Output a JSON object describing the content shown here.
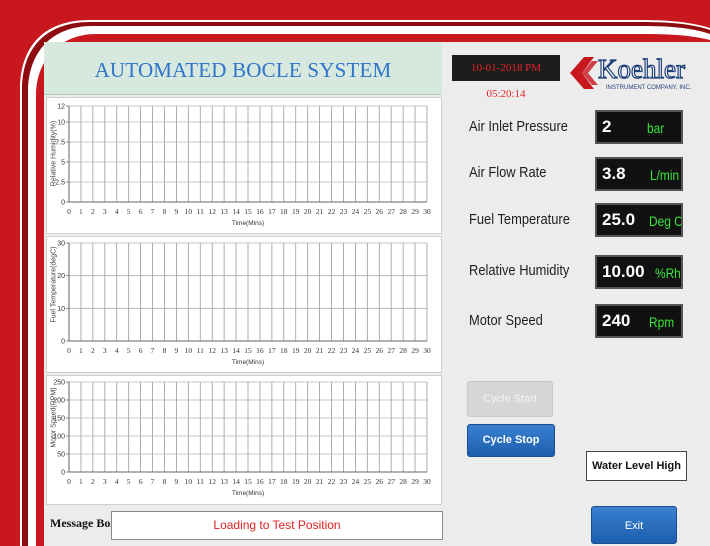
{
  "app": {
    "title": "AUTOMATED BOCLE SYSTEM",
    "datetime": "10-01-2018 PM 05:20:14"
  },
  "logo": {
    "name": "Koehler",
    "subtitle": "INSTRUMENT COMPANY, INC."
  },
  "colors": {
    "frame_red": "#c8171d",
    "title_blue": "#2e74c9",
    "value_green": "#37e637",
    "message_red": "#e02020",
    "button_blue": "#1d5fae"
  },
  "parameters": [
    {
      "label": "Air Inlet Pressure",
      "value": "2",
      "unit": "bar"
    },
    {
      "label": "Air Flow Rate",
      "value": "3.8",
      "unit": "L/min"
    },
    {
      "label": "Fuel Temperature",
      "value": "25.0",
      "unit": "Deg C"
    },
    {
      "label": "Relative Humidity",
      "value": "10.00",
      "unit": "%Rh"
    },
    {
      "label": "Motor Speed",
      "value": "240",
      "unit": "Rpm"
    }
  ],
  "buttons": {
    "cycle_start": "Cycle Start",
    "cycle_stop": "Cycle Stop",
    "exit": "Exit"
  },
  "status": {
    "water_level": "Water Level High"
  },
  "message": {
    "label": "Message Box",
    "text": "Loading to Test Position"
  },
  "chart_data": [
    {
      "type": "line",
      "xlabel": "Time(Mins)",
      "ylabel": "Relative Humidity(%)",
      "xlim": [
        0,
        30
      ],
      "ylim": [
        0,
        12
      ],
      "x_ticks": [
        "0",
        "1",
        "2",
        "3",
        "4",
        "5",
        "6",
        "7",
        "8",
        "9",
        "10",
        "11",
        "12",
        "13",
        "14",
        "15",
        "16",
        "17",
        "18",
        "19",
        "20",
        "21",
        "22",
        "23",
        "24",
        "25",
        "26",
        "27",
        "28",
        "29",
        "30"
      ],
      "y_ticks": [
        "0",
        "2.5",
        "5",
        "7.5",
        "10",
        "12"
      ],
      "grid": true,
      "series": []
    },
    {
      "type": "line",
      "xlabel": "Time(Mins)",
      "ylabel": "Fuel Temperature(degC)",
      "xlim": [
        0,
        30
      ],
      "ylim": [
        0,
        30
      ],
      "x_ticks": [
        "0",
        "1",
        "2",
        "3",
        "4",
        "5",
        "6",
        "7",
        "8",
        "9",
        "10",
        "11",
        "12",
        "13",
        "14",
        "15",
        "16",
        "17",
        "18",
        "19",
        "20",
        "21",
        "22",
        "23",
        "24",
        "25",
        "26",
        "27",
        "28",
        "29",
        "30"
      ],
      "y_ticks": [
        "0",
        "10",
        "20",
        "30"
      ],
      "grid": true,
      "series": []
    },
    {
      "type": "line",
      "xlabel": "Time(Mins)",
      "ylabel": "Motor Speed(RPM)",
      "xlim": [
        0,
        30
      ],
      "ylim": [
        0,
        250
      ],
      "x_ticks": [
        "0",
        "1",
        "2",
        "3",
        "4",
        "5",
        "6",
        "7",
        "8",
        "9",
        "10",
        "11",
        "12",
        "13",
        "14",
        "15",
        "16",
        "17",
        "18",
        "19",
        "20",
        "21",
        "22",
        "23",
        "24",
        "25",
        "26",
        "27",
        "28",
        "29",
        "30"
      ],
      "y_ticks": [
        "0",
        "50",
        "100",
        "150",
        "200",
        "250"
      ],
      "grid": true,
      "series": []
    }
  ]
}
